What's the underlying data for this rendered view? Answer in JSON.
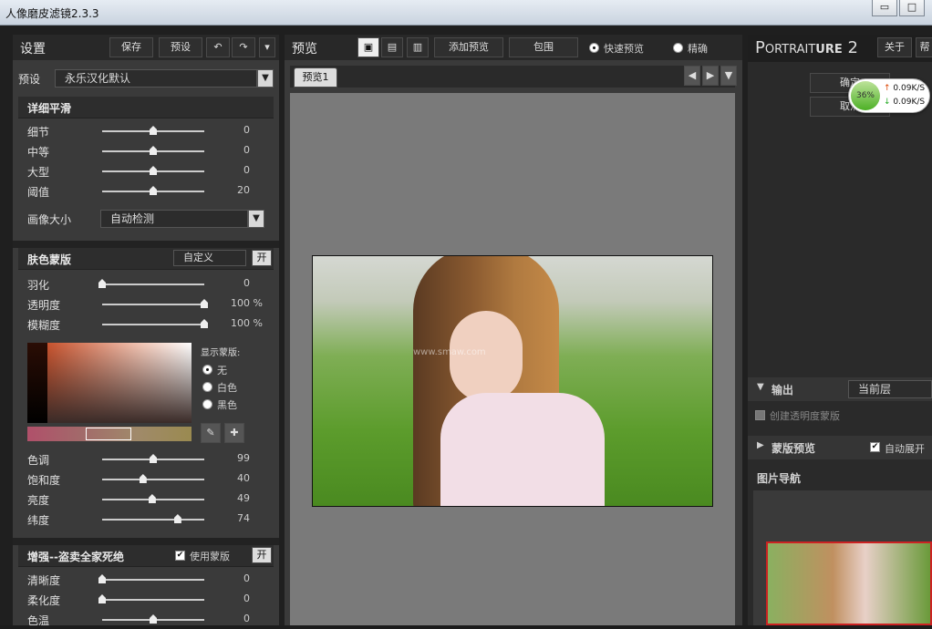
{
  "window": {
    "title": "人像磨皮滤镜2.3.3",
    "min": "▭",
    "max": "□"
  },
  "left": {
    "header": "设置",
    "save": "保存",
    "preset_btn": "预设",
    "undo": "↶",
    "redo": "↷",
    "menu": "▾",
    "preset_label": "预设",
    "preset_value": "永乐汉化默认",
    "detail": {
      "title": "详细平滑",
      "sliders": [
        {
          "label": "细节",
          "value": "0",
          "pct": 0.5
        },
        {
          "label": "中等",
          "value": "0",
          "pct": 0.5
        },
        {
          "label": "大型",
          "value": "0",
          "pct": 0.5
        },
        {
          "label": "阈值",
          "value": "20",
          "pct": 0.5
        }
      ],
      "size_label": "画像大小",
      "size_value": "自动检测"
    },
    "mask": {
      "title": "肤色蒙版",
      "mode": "自定义",
      "toggle": "开",
      "sliders": [
        {
          "label": "羽化",
          "value": "0",
          "unit": "",
          "pct": 0.0
        },
        {
          "label": "透明度",
          "value": "100",
          "unit": "%",
          "pct": 1.0
        },
        {
          "label": "模糊度",
          "value": "100",
          "unit": "%",
          "pct": 1.0
        }
      ],
      "show_label": "显示蒙版:",
      "radios": [
        "无",
        "白色",
        "黑色"
      ],
      "hsl": [
        {
          "label": "色调",
          "value": "99",
          "pct": 0.5
        },
        {
          "label": "饱和度",
          "value": "40",
          "pct": 0.4
        },
        {
          "label": "亮度",
          "value": "49",
          "pct": 0.49
        },
        {
          "label": "纬度",
          "value": "74",
          "pct": 0.74
        }
      ]
    },
    "enhance": {
      "title": "增强--盗卖全家死绝",
      "use_mask": "使用蒙版",
      "toggle": "开",
      "sliders": [
        {
          "label": "清晰度",
          "value": "0",
          "pct": 0.0
        },
        {
          "label": "柔化度",
          "value": "0",
          "pct": 0.0
        },
        {
          "label": "色温",
          "value": "0",
          "pct": 0.5
        }
      ]
    }
  },
  "mid": {
    "header": "预览",
    "add": "添加预览",
    "wrap": "包围",
    "fast": "快速预览",
    "precise": "精确",
    "tab": "预览1",
    "watermark": "www.smaw.com"
  },
  "right": {
    "brand_a": "P",
    "brand_b": "ORTRAIT",
    "brand_c": "URE",
    "brand_d": "2",
    "about": "关于",
    "help": "帮",
    "ok": "确定",
    "cancel": "取消",
    "net": {
      "pct": "36%",
      "up": "0.09K/S",
      "down": "0.09K/S"
    },
    "output": {
      "title": "输出",
      "value": "当前层",
      "opt": "创建透明度蒙版"
    },
    "maskprev": {
      "title": "蒙版预览",
      "auto": "自动展开"
    },
    "nav": {
      "title": "图片导航"
    }
  }
}
